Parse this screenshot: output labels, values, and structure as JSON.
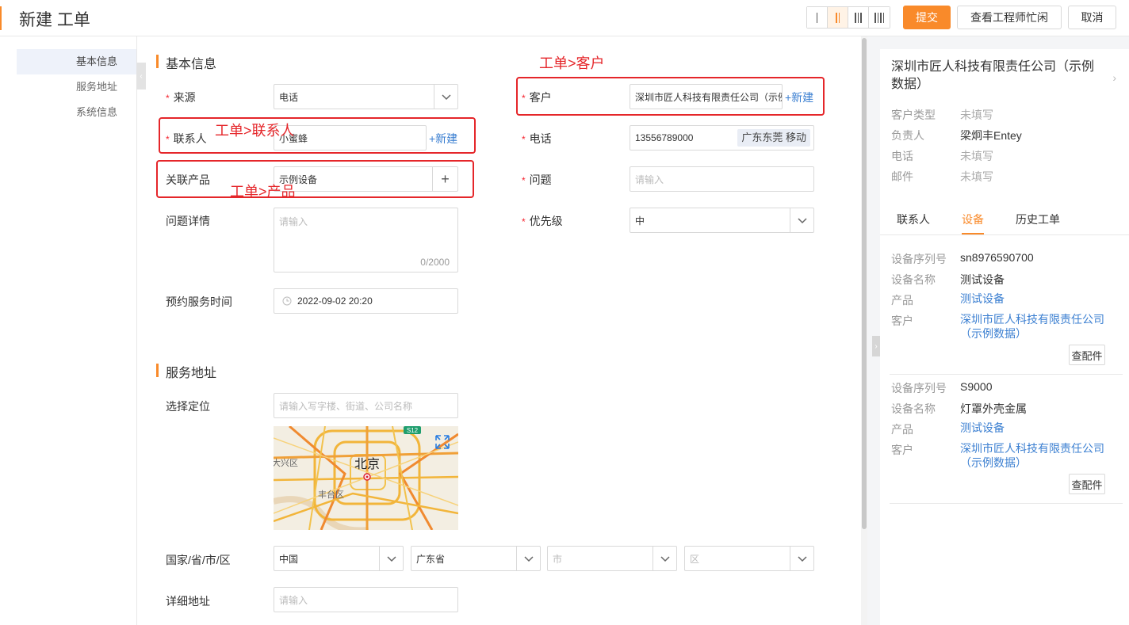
{
  "header": {
    "title": "新建 工单",
    "submit_label": "提交",
    "engineer_busy_label": "查看工程师忙闲",
    "cancel_label": "取消"
  },
  "side_nav": {
    "items": [
      {
        "label": "基本信息"
      },
      {
        "label": "服务地址"
      },
      {
        "label": "系统信息"
      }
    ]
  },
  "basic_info": {
    "section_title": "基本信息",
    "source": {
      "label": "来源",
      "value": "电话"
    },
    "contact": {
      "label": "联系人",
      "value": "小蜜蜂",
      "new_link": "+新建"
    },
    "product": {
      "label": "关联产品",
      "value": "示例设备"
    },
    "issue_detail": {
      "label": "问题详情",
      "placeholder": "请输入",
      "counter": "0/2000"
    },
    "appointment": {
      "label": "预约服务时间",
      "value": "2022-09-02 20:20"
    },
    "customer": {
      "label": "客户",
      "value": "深圳市匠人科技有限责任公司（示例数据）",
      "new_link": "+新建"
    },
    "phone": {
      "label": "电话",
      "value": "13556789000",
      "tag": "广东东莞 移动"
    },
    "issue": {
      "label": "问题",
      "placeholder": "请输入"
    },
    "priority": {
      "label": "优先级",
      "value": "中"
    }
  },
  "annotations": {
    "contact": "工单>联系人",
    "product": "工单>产品",
    "customer": "工单>客户"
  },
  "service_address": {
    "section_title": "服务地址",
    "location": {
      "label": "选择定位",
      "placeholder": "请输入写字楼、街道、公司名称"
    },
    "map_labels": {
      "city": "北京",
      "district_west": "大兴区",
      "district_south": "丰台区",
      "road": "S12"
    },
    "region": {
      "label": "国家/省/市/区",
      "country": "中国",
      "province": "广东省",
      "city_placeholder": "市",
      "district_placeholder": "区"
    },
    "detail": {
      "label": "详细地址",
      "placeholder": "请输入"
    }
  },
  "right_panel": {
    "customer_name": "深圳市匠人科技有限责任公司（示例数据）",
    "info": [
      {
        "key": "客户类型",
        "value": "未填写"
      },
      {
        "key": "负责人",
        "value": "梁炯丰Entey"
      },
      {
        "key": "电话",
        "value": "未填写"
      },
      {
        "key": "邮件",
        "value": "未填写"
      }
    ],
    "tabs": [
      {
        "label": "联系人"
      },
      {
        "label": "设备"
      },
      {
        "label": "历史工单"
      }
    ],
    "devices": [
      {
        "serial_key": "设备序列号",
        "serial": "sn8976590700",
        "name_key": "设备名称",
        "name": "测试设备",
        "product_key": "产品",
        "product": "测试设备",
        "customer_key": "客户",
        "customer": "深圳市匠人科技有限责任公司（示例数据）",
        "parts_label": "查配件"
      },
      {
        "serial_key": "设备序列号",
        "serial": "S9000",
        "name_key": "设备名称",
        "name": "灯罩外壳金属",
        "product_key": "产品",
        "product": "测试设备",
        "customer_key": "客户",
        "customer": "深圳市匠人科技有限责任公司（示例数据）",
        "parts_label": "查配件"
      }
    ]
  },
  "colors": {
    "accent": "#f98a2a",
    "link": "#3b7fd1",
    "annotation": "#e5262a"
  }
}
